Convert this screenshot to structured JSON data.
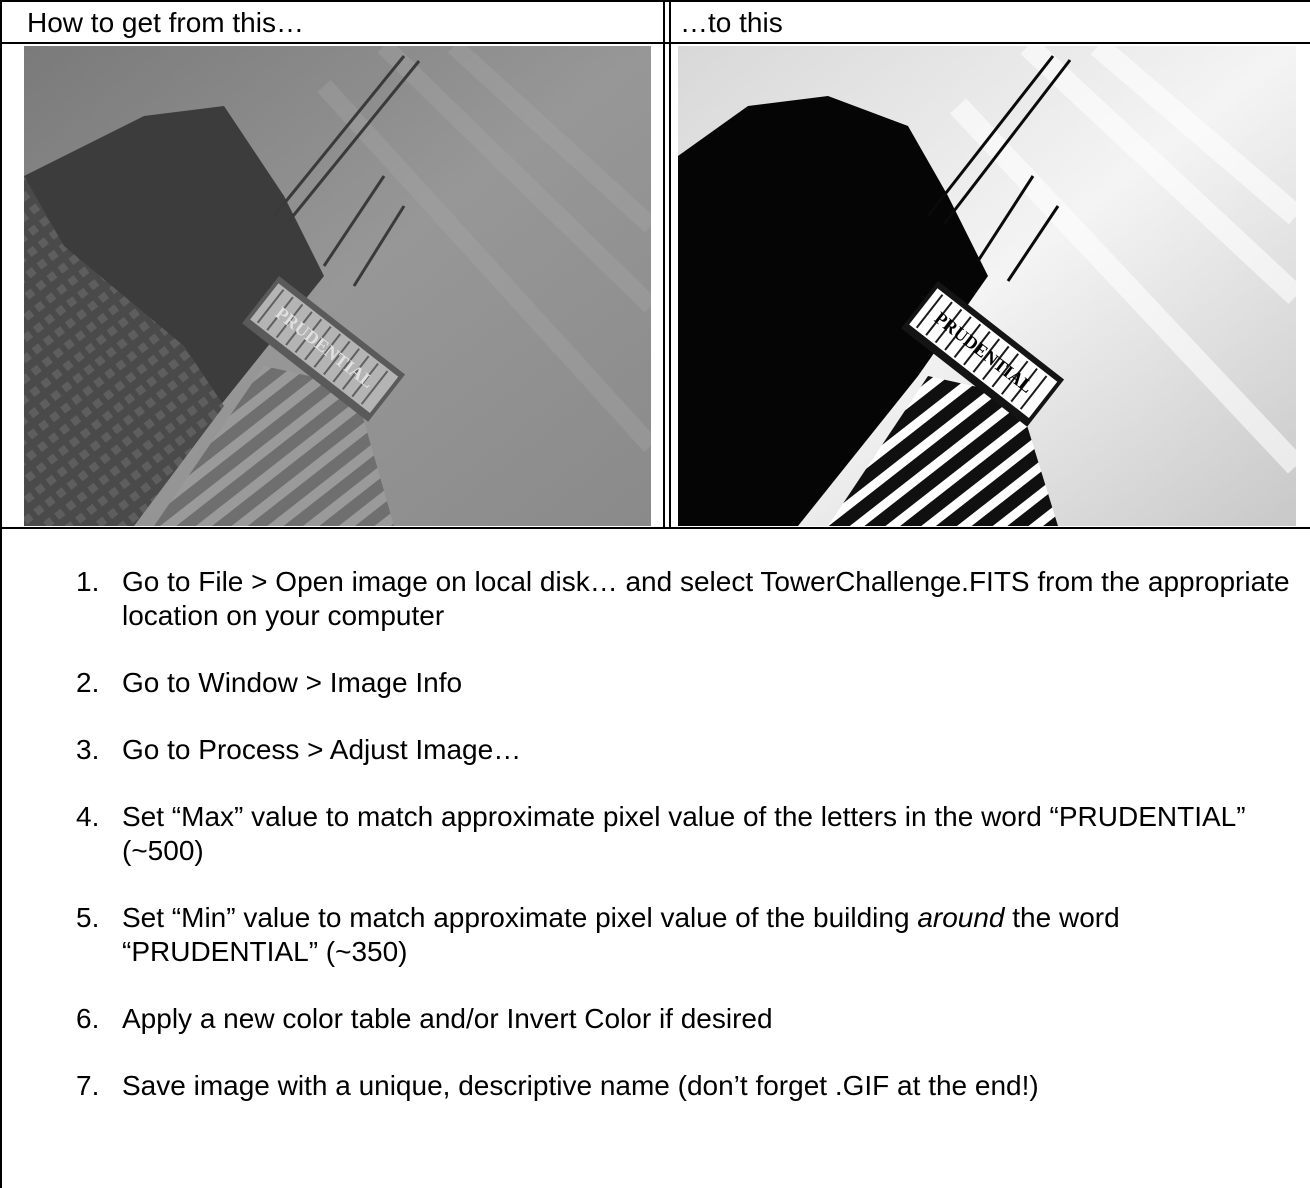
{
  "header": {
    "left": "How to get from this…",
    "right": "…to this"
  },
  "images": {
    "before": {
      "sign_text": "PRUDENTIAL"
    },
    "after": {
      "sign_text": "PRUDENTIAL"
    }
  },
  "steps": [
    {
      "num": "1.",
      "text": "Go to File > Open image on local disk… and select TowerChallenge.FITS from the appropriate location on your computer"
    },
    {
      "num": "2.",
      "text": "Go to Window > Image Info"
    },
    {
      "num": "3.",
      "text": "Go to Process > Adjust Image…"
    },
    {
      "num": "4.",
      "text": "Set “Max” value to match approximate pixel value of the letters in the word “PRUDENTIAL” (~500)"
    },
    {
      "num": "5.",
      "pre": "Set “Min” value to match approximate pixel value of the building ",
      "em": "around",
      "post": " the word “PRUDENTIAL” (~350)"
    },
    {
      "num": "6.",
      "text": "Apply a new color table and/or Invert Color if desired"
    },
    {
      "num": "7.",
      "text": "Save image with a unique, descriptive name (don’t forget .GIF at the end!)"
    }
  ]
}
